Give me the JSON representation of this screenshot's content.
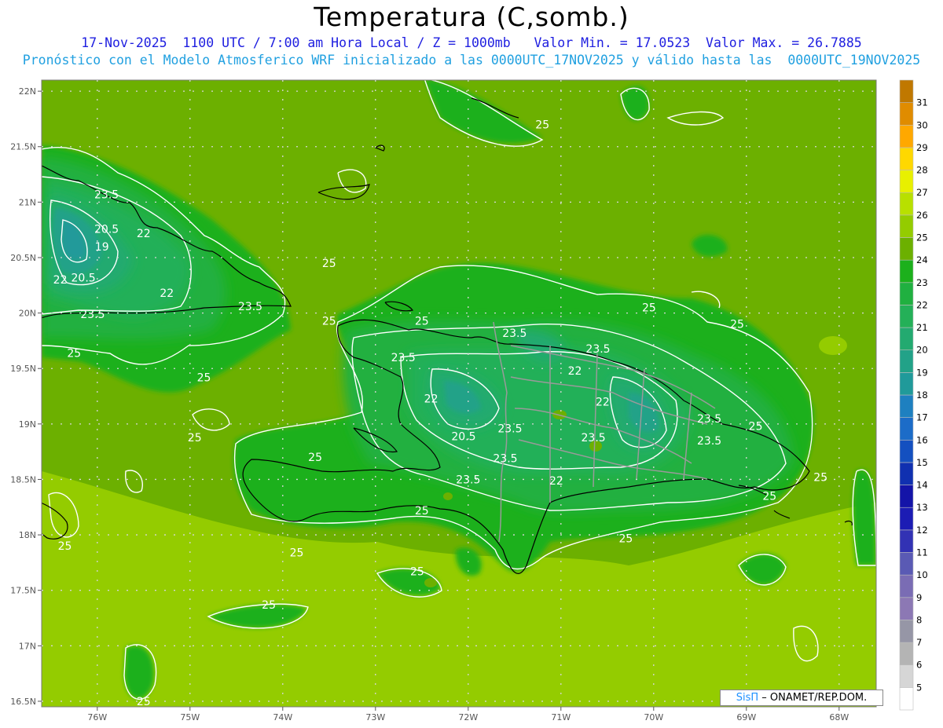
{
  "header": {
    "title": "Temperatura (C,somb.)",
    "line1": "17-Nov-2025  1100 UTC / 7:00 am Hora Local / Z = 1000mb   Valor Min. = 17.0523  Valor Max. = 26.7885",
    "line2": "Pronóstico con el Modelo Atmosferico WRF inicializado a las 0000UTC_17NOV2025 y válido hasta las  0000UTC_19NOV2025"
  },
  "map": {
    "lat_labels": [
      "22N",
      "21.5N",
      "21N",
      "20.5N",
      "20N",
      "19.5N",
      "19N",
      "18.5N",
      "18N",
      "17.5N",
      "17N",
      "16.5N"
    ],
    "lon_labels": [
      "76W",
      "75W",
      "74W",
      "73W",
      "72W",
      "71W",
      "70W",
      "69W",
      "68W"
    ],
    "contour_labels": [
      {
        "text": "25",
        "lon": -71.2,
        "lat": 21.7
      },
      {
        "text": "23.5",
        "lon": -75.9,
        "lat": 21.07
      },
      {
        "text": "20.5",
        "lon": -75.9,
        "lat": 20.76
      },
      {
        "text": "22",
        "lon": -75.5,
        "lat": 20.72
      },
      {
        "text": "19",
        "lon": -75.95,
        "lat": 20.6
      },
      {
        "text": "20.5",
        "lon": -76.15,
        "lat": 20.32
      },
      {
        "text": "22",
        "lon": -76.4,
        "lat": 20.3
      },
      {
        "text": "22",
        "lon": -75.25,
        "lat": 20.18
      },
      {
        "text": "23.5",
        "lon": -76.05,
        "lat": 19.99
      },
      {
        "text": "23.5",
        "lon": -74.35,
        "lat": 20.06
      },
      {
        "text": "25",
        "lon": -73.5,
        "lat": 20.45
      },
      {
        "text": "25",
        "lon": -73.5,
        "lat": 19.93
      },
      {
        "text": "25",
        "lon": -72.5,
        "lat": 19.93
      },
      {
        "text": "25",
        "lon": -76.25,
        "lat": 19.64
      },
      {
        "text": "25",
        "lon": -74.85,
        "lat": 19.42
      },
      {
        "text": "23.5",
        "lon": -72.7,
        "lat": 19.6
      },
      {
        "text": "23.5",
        "lon": -71.5,
        "lat": 19.82
      },
      {
        "text": "23.5",
        "lon": -70.6,
        "lat": 19.68
      },
      {
        "text": "22",
        "lon": -70.85,
        "lat": 19.48
      },
      {
        "text": "25",
        "lon": -70.05,
        "lat": 20.05
      },
      {
        "text": "25",
        "lon": -69.1,
        "lat": 19.9
      },
      {
        "text": "22",
        "lon": -72.4,
        "lat": 19.23
      },
      {
        "text": "22",
        "lon": -70.55,
        "lat": 19.2
      },
      {
        "text": "23.5",
        "lon": -69.4,
        "lat": 19.05
      },
      {
        "text": "25",
        "lon": -68.9,
        "lat": 18.98
      },
      {
        "text": "20.5",
        "lon": -72.05,
        "lat": 18.89
      },
      {
        "text": "23.5",
        "lon": -71.55,
        "lat": 18.96
      },
      {
        "text": "23.5",
        "lon": -70.65,
        "lat": 18.88
      },
      {
        "text": "23.5",
        "lon": -69.4,
        "lat": 18.85
      },
      {
        "text": "25",
        "lon": -74.95,
        "lat": 18.88
      },
      {
        "text": "25",
        "lon": -73.65,
        "lat": 18.7
      },
      {
        "text": "23.5",
        "lon": -71.6,
        "lat": 18.69
      },
      {
        "text": "23.5",
        "lon": -72,
        "lat": 18.5
      },
      {
        "text": "22",
        "lon": -71.05,
        "lat": 18.49
      },
      {
        "text": "25",
        "lon": -68.2,
        "lat": 18.52
      },
      {
        "text": "25",
        "lon": -68.75,
        "lat": 18.35
      },
      {
        "text": "25",
        "lon": -72.5,
        "lat": 18.22
      },
      {
        "text": "25",
        "lon": -76.35,
        "lat": 17.9
      },
      {
        "text": "25",
        "lon": -73.85,
        "lat": 17.84
      },
      {
        "text": "25",
        "lon": -70.3,
        "lat": 17.97
      },
      {
        "text": "25",
        "lon": -72.55,
        "lat": 17.67
      },
      {
        "text": "25",
        "lon": -74.15,
        "lat": 17.37
      },
      {
        "text": "25",
        "lon": -75.5,
        "lat": 16.5
      }
    ]
  },
  "colorbar": {
    "values": [
      "5",
      "6",
      "7",
      "8",
      "9",
      "10",
      "11",
      "12",
      "13",
      "14",
      "15",
      "16",
      "17",
      "18",
      "19",
      "20",
      "21",
      "22",
      "23",
      "24",
      "25",
      "26",
      "27",
      "28",
      "29",
      "30",
      "31"
    ],
    "colors": [
      "#ffffff",
      "#d6d6d6",
      "#b4b4b4",
      "#9696a6",
      "#8c78b4",
      "#7a6cb4",
      "#5a5ab4",
      "#3232b4",
      "#1c1cb4",
      "#1414a8",
      "#1030b0",
      "#1450c0",
      "#1c6cc8",
      "#1e80c0",
      "#209a9a",
      "#22a288",
      "#23aa70",
      "#24b058",
      "#20b040",
      "#1cb01c",
      "#6cb000",
      "#94cc00",
      "#b8e000",
      "#e8f000",
      "#ffd800",
      "#ffa800",
      "#e08c00",
      "#c07800"
    ]
  },
  "credit": {
    "brand": "SisΠ",
    "rest": " – ONAMET/REP.DOM."
  }
}
